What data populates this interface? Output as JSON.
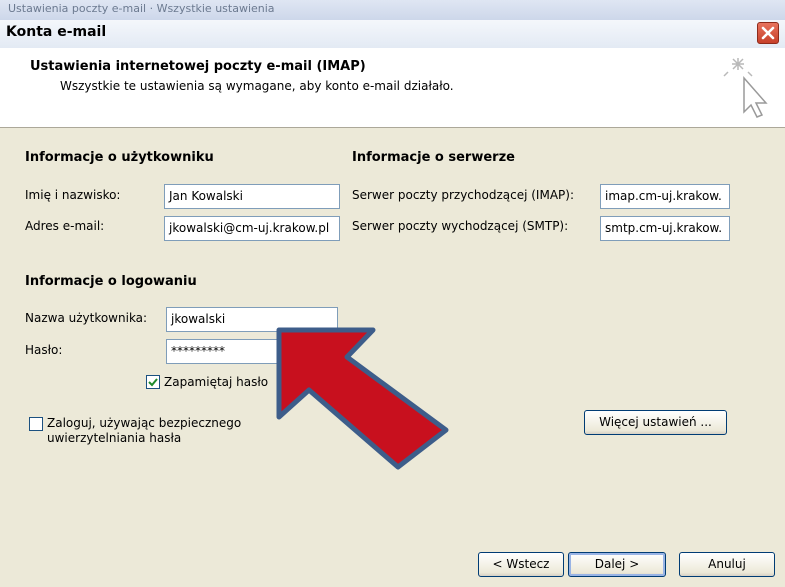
{
  "background_strip": {
    "text": "Ustawienia poczty e-mail · Wszystkie ustawienia"
  },
  "window": {
    "title": "Konta e-mail"
  },
  "header": {
    "title": "Ustawienia internetowej poczty e-mail (IMAP)",
    "subtitle": "Wszystkie te ustawienia są wymagane, aby konto e-mail działało."
  },
  "user_info": {
    "heading": "Informacje o użytkowniku",
    "name_label": "Imię i nazwisko:",
    "name_value": "Jan Kowalski",
    "email_label": "Adres e-mail:",
    "email_value": "jkowalski@cm-uj.krakow.pl"
  },
  "server_info": {
    "heading": "Informacje o serwerze",
    "incoming_label": "Serwer poczty przychodzącej (IMAP):",
    "incoming_value": "imap.cm-uj.krakow.",
    "outgoing_label": "Serwer poczty wychodzącej (SMTP):",
    "outgoing_value": "smtp.cm-uj.krakow."
  },
  "login_info": {
    "heading": "Informacje o logowaniu",
    "username_label": "Nazwa użytkownika:",
    "username_value": "jkowalski",
    "password_label": "Hasło:",
    "password_value": "*********",
    "remember_label": "Zapamiętaj hasło",
    "remember_checked": true,
    "spa_label_line1": "Zaloguj, używając bezpiecznego",
    "spa_label_line2": "uwierzytelniania hasła",
    "spa_checked": false
  },
  "buttons": {
    "more_settings": "Więcej ustawień ...",
    "back": "< Wstecz",
    "next": "Dalej >",
    "cancel": "Anuluj"
  },
  "colors": {
    "annotation_arrow_fill": "#c8101e",
    "annotation_arrow_border": "#3d5d8a",
    "checkmark": "#1e8a2b"
  },
  "icons": {
    "header_icon": "sparkle-cursor-icon",
    "close": "close-icon",
    "annotation": "pointer-arrow-annotation"
  }
}
